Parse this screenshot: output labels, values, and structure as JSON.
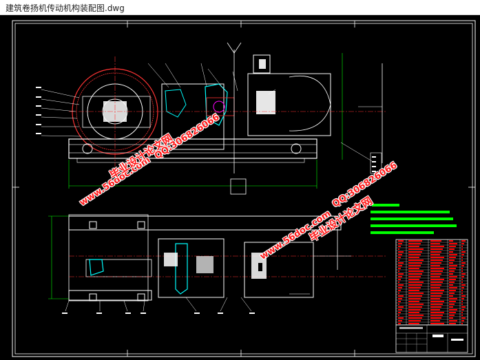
{
  "window": {
    "title": "建筑卷扬机传动机构装配图.dwg"
  },
  "watermarks": {
    "site": "www.56doc.com",
    "brand": "毕业设计论文网",
    "qq": "QQ:306826066"
  },
  "colors": {
    "background": "#000000",
    "frame": "#ffffff",
    "red": "#ff0000",
    "cyan": "#00ffff",
    "green": "#00ff00",
    "magenta": "#ff00ff",
    "yellow": "#ffff00"
  }
}
